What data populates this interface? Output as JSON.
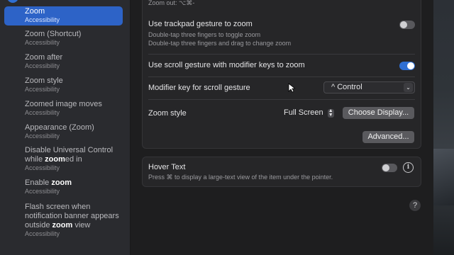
{
  "sidebar": {
    "items": [
      {
        "title_parts": [
          {
            "t": "Zoom",
            "h": false
          }
        ],
        "category": "Accessibility",
        "selected": true
      },
      {
        "title_parts": [
          {
            "t": "Zoom",
            "h": false
          },
          {
            "t": " (Shortcut)",
            "h": false
          }
        ],
        "category": "Accessibility"
      },
      {
        "title_parts": [
          {
            "t": "Zoom",
            "h": false
          },
          {
            "t": " after",
            "h": false
          }
        ],
        "category": "Accessibility"
      },
      {
        "title_parts": [
          {
            "t": "Zoom",
            "h": false
          },
          {
            "t": " style",
            "h": false
          }
        ],
        "category": "Accessibility"
      },
      {
        "title_parts": [
          {
            "t": "Zoom",
            "h": false
          },
          {
            "t": "ed image moves",
            "h": false
          }
        ],
        "category": "Accessibility"
      },
      {
        "title_parts": [
          {
            "t": "Appearance (",
            "h": false
          },
          {
            "t": "Zoom",
            "h": false
          },
          {
            "t": ")",
            "h": false
          }
        ],
        "category": "Accessibility"
      },
      {
        "title_parts": [
          {
            "t": "Disable Universal Control while ",
            "h": false
          },
          {
            "t": "zoom",
            "h": true
          },
          {
            "t": "ed in",
            "h": false
          }
        ],
        "category": "Accessibility"
      },
      {
        "title_parts": [
          {
            "t": "Enable ",
            "h": false
          },
          {
            "t": "zoom",
            "h": true
          }
        ],
        "category": "Accessibility"
      },
      {
        "title_parts": [
          {
            "t": "Flash screen when notification banner appears outside ",
            "h": false
          },
          {
            "t": "zoom",
            "h": true
          },
          {
            "t": " view",
            "h": false
          }
        ],
        "category": "Accessibility"
      }
    ]
  },
  "main": {
    "zoom_out_partial": "Zoom out: ⌥⌘-",
    "trackpad": {
      "title": "Use trackpad gesture to zoom",
      "sub1": "Double-tap three fingers to toggle zoom",
      "sub2": "Double-tap three fingers and drag to change zoom",
      "enabled": false
    },
    "scroll": {
      "title": "Use scroll gesture with modifier keys to zoom",
      "enabled": true
    },
    "modifier": {
      "label": "Modifier key for scroll gesture",
      "value": "^ Control"
    },
    "zoom_style": {
      "label": "Zoom style",
      "value": "Full Screen",
      "choose_display_label": "Choose Display..."
    },
    "advanced_label": "Advanced...",
    "hover_text": {
      "title": "Hover Text",
      "sub": "Press ⌘ to display a large-text view of the item under the pointer.",
      "enabled": false
    },
    "help_label": "?"
  },
  "colors": {
    "accent": "#2f6fd3",
    "sidebar_selected": "#2d63c7"
  }
}
